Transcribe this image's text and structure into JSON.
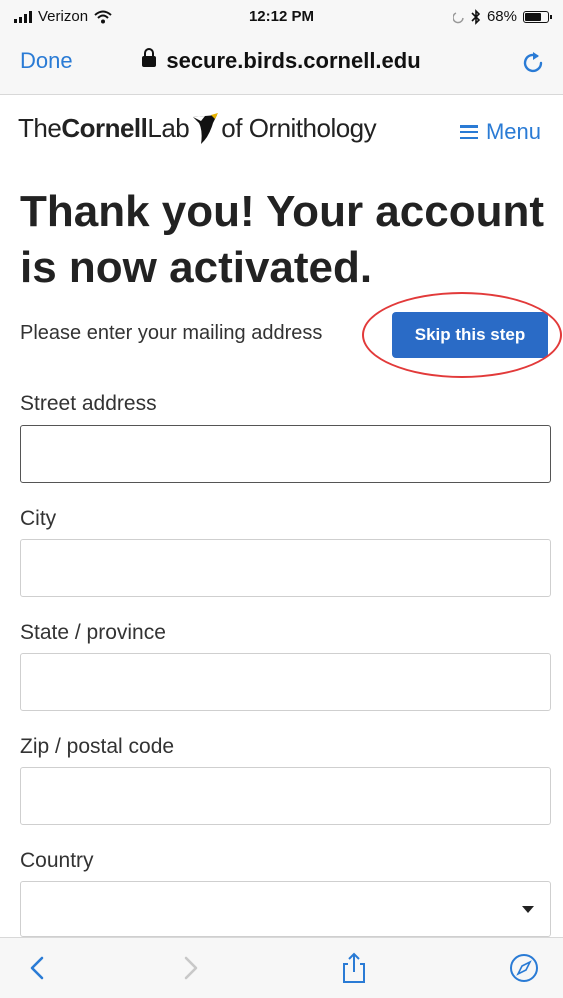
{
  "status_bar": {
    "carrier": "Verizon",
    "time": "12:12 PM",
    "battery": "68%"
  },
  "browser": {
    "done_label": "Done",
    "url": "secure.birds.cornell.edu"
  },
  "site": {
    "logo_the": "The",
    "logo_cornell": "Cornell",
    "logo_lab": "Lab",
    "logo_of": "of Ornithology",
    "menu_label": "Menu"
  },
  "page": {
    "title": "Thank you! Your account is now activated.",
    "intro": "Please enter your mailing address",
    "skip_label": "Skip this step"
  },
  "form": {
    "street_label": "Street address",
    "street_value": "",
    "city_label": "City",
    "city_value": "",
    "state_label": "State / province",
    "state_value": "",
    "zip_label": "Zip / postal code",
    "zip_value": "",
    "country_label": "Country",
    "country_value": ""
  },
  "colors": {
    "link_blue": "#2a7bd5",
    "button_blue": "#2a6bc6",
    "highlight_red": "#e23a3a"
  },
  "icons": {
    "wifi": "wifi-icon",
    "bluetooth": "bluetooth-icon",
    "lock": "lock-icon",
    "reload": "reload-icon",
    "back": "back-icon",
    "forward": "forward-icon",
    "share": "share-icon",
    "compass": "compass-icon"
  }
}
